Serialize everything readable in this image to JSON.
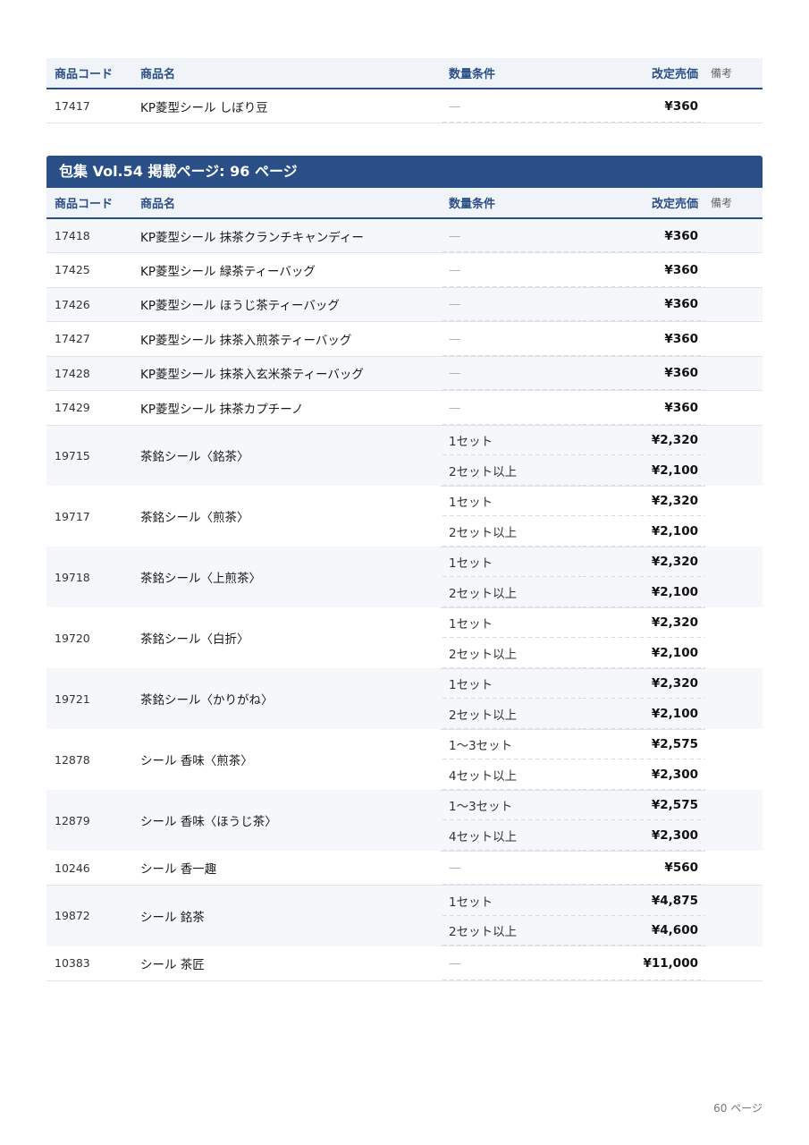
{
  "headers": {
    "code": "商品コード",
    "name": "商品名",
    "cond": "数量条件",
    "price": "改定売価",
    "note": "備考"
  },
  "top_table": {
    "rows": [
      {
        "code": "17417",
        "name": "KP菱型シール しぼり豆",
        "tiers": [
          {
            "cond": "—",
            "price": "¥360"
          }
        ]
      }
    ]
  },
  "section": {
    "title": "包集 Vol.54 掲載ページ: 96 ページ"
  },
  "main_table": {
    "rows": [
      {
        "code": "17418",
        "name": "KP菱型シール 抹茶クランチキャンディー",
        "tiers": [
          {
            "cond": "—",
            "price": "¥360"
          }
        ]
      },
      {
        "code": "17425",
        "name": "KP菱型シール 緑茶ティーバッグ",
        "tiers": [
          {
            "cond": "—",
            "price": "¥360"
          }
        ]
      },
      {
        "code": "17426",
        "name": "KP菱型シール ほうじ茶ティーバッグ",
        "tiers": [
          {
            "cond": "—",
            "price": "¥360"
          }
        ]
      },
      {
        "code": "17427",
        "name": "KP菱型シール 抹茶入煎茶ティーバッグ",
        "tiers": [
          {
            "cond": "—",
            "price": "¥360"
          }
        ]
      },
      {
        "code": "17428",
        "name": "KP菱型シール 抹茶入玄米茶ティーバッグ",
        "tiers": [
          {
            "cond": "—",
            "price": "¥360"
          }
        ]
      },
      {
        "code": "17429",
        "name": "KP菱型シール 抹茶カプチーノ",
        "tiers": [
          {
            "cond": "—",
            "price": "¥360"
          }
        ]
      },
      {
        "code": "19715",
        "name": "茶銘シール〈銘茶〉",
        "tiers": [
          {
            "cond": "1セット",
            "price": "¥2,320"
          },
          {
            "cond": "2セット以上",
            "price": "¥2,100"
          }
        ]
      },
      {
        "code": "19717",
        "name": "茶銘シール〈煎茶〉",
        "tiers": [
          {
            "cond": "1セット",
            "price": "¥2,320"
          },
          {
            "cond": "2セット以上",
            "price": "¥2,100"
          }
        ]
      },
      {
        "code": "19718",
        "name": "茶銘シール〈上煎茶〉",
        "tiers": [
          {
            "cond": "1セット",
            "price": "¥2,320"
          },
          {
            "cond": "2セット以上",
            "price": "¥2,100"
          }
        ]
      },
      {
        "code": "19720",
        "name": "茶銘シール〈白折〉",
        "tiers": [
          {
            "cond": "1セット",
            "price": "¥2,320"
          },
          {
            "cond": "2セット以上",
            "price": "¥2,100"
          }
        ]
      },
      {
        "code": "19721",
        "name": "茶銘シール〈かりがね〉",
        "tiers": [
          {
            "cond": "1セット",
            "price": "¥2,320"
          },
          {
            "cond": "2セット以上",
            "price": "¥2,100"
          }
        ]
      },
      {
        "code": "12878",
        "name": "シール 香味〈煎茶〉",
        "tiers": [
          {
            "cond": "1～3セット",
            "price": "¥2,575"
          },
          {
            "cond": "4セット以上",
            "price": "¥2,300"
          }
        ]
      },
      {
        "code": "12879",
        "name": "シール 香味〈ほうじ茶〉",
        "tiers": [
          {
            "cond": "1～3セット",
            "price": "¥2,575"
          },
          {
            "cond": "4セット以上",
            "price": "¥2,300"
          }
        ]
      },
      {
        "code": "10246",
        "name": "シール 香一趣",
        "tiers": [
          {
            "cond": "—",
            "price": "¥560"
          }
        ]
      },
      {
        "code": "19872",
        "name": "シール 銘茶",
        "tiers": [
          {
            "cond": "1セット",
            "price": "¥4,875"
          },
          {
            "cond": "2セット以上",
            "price": "¥4,600"
          }
        ]
      },
      {
        "code": "10383",
        "name": "シール 茶匠",
        "tiers": [
          {
            "cond": "—",
            "price": "¥11,000"
          }
        ]
      }
    ]
  },
  "footer": {
    "page": "60 ページ"
  }
}
